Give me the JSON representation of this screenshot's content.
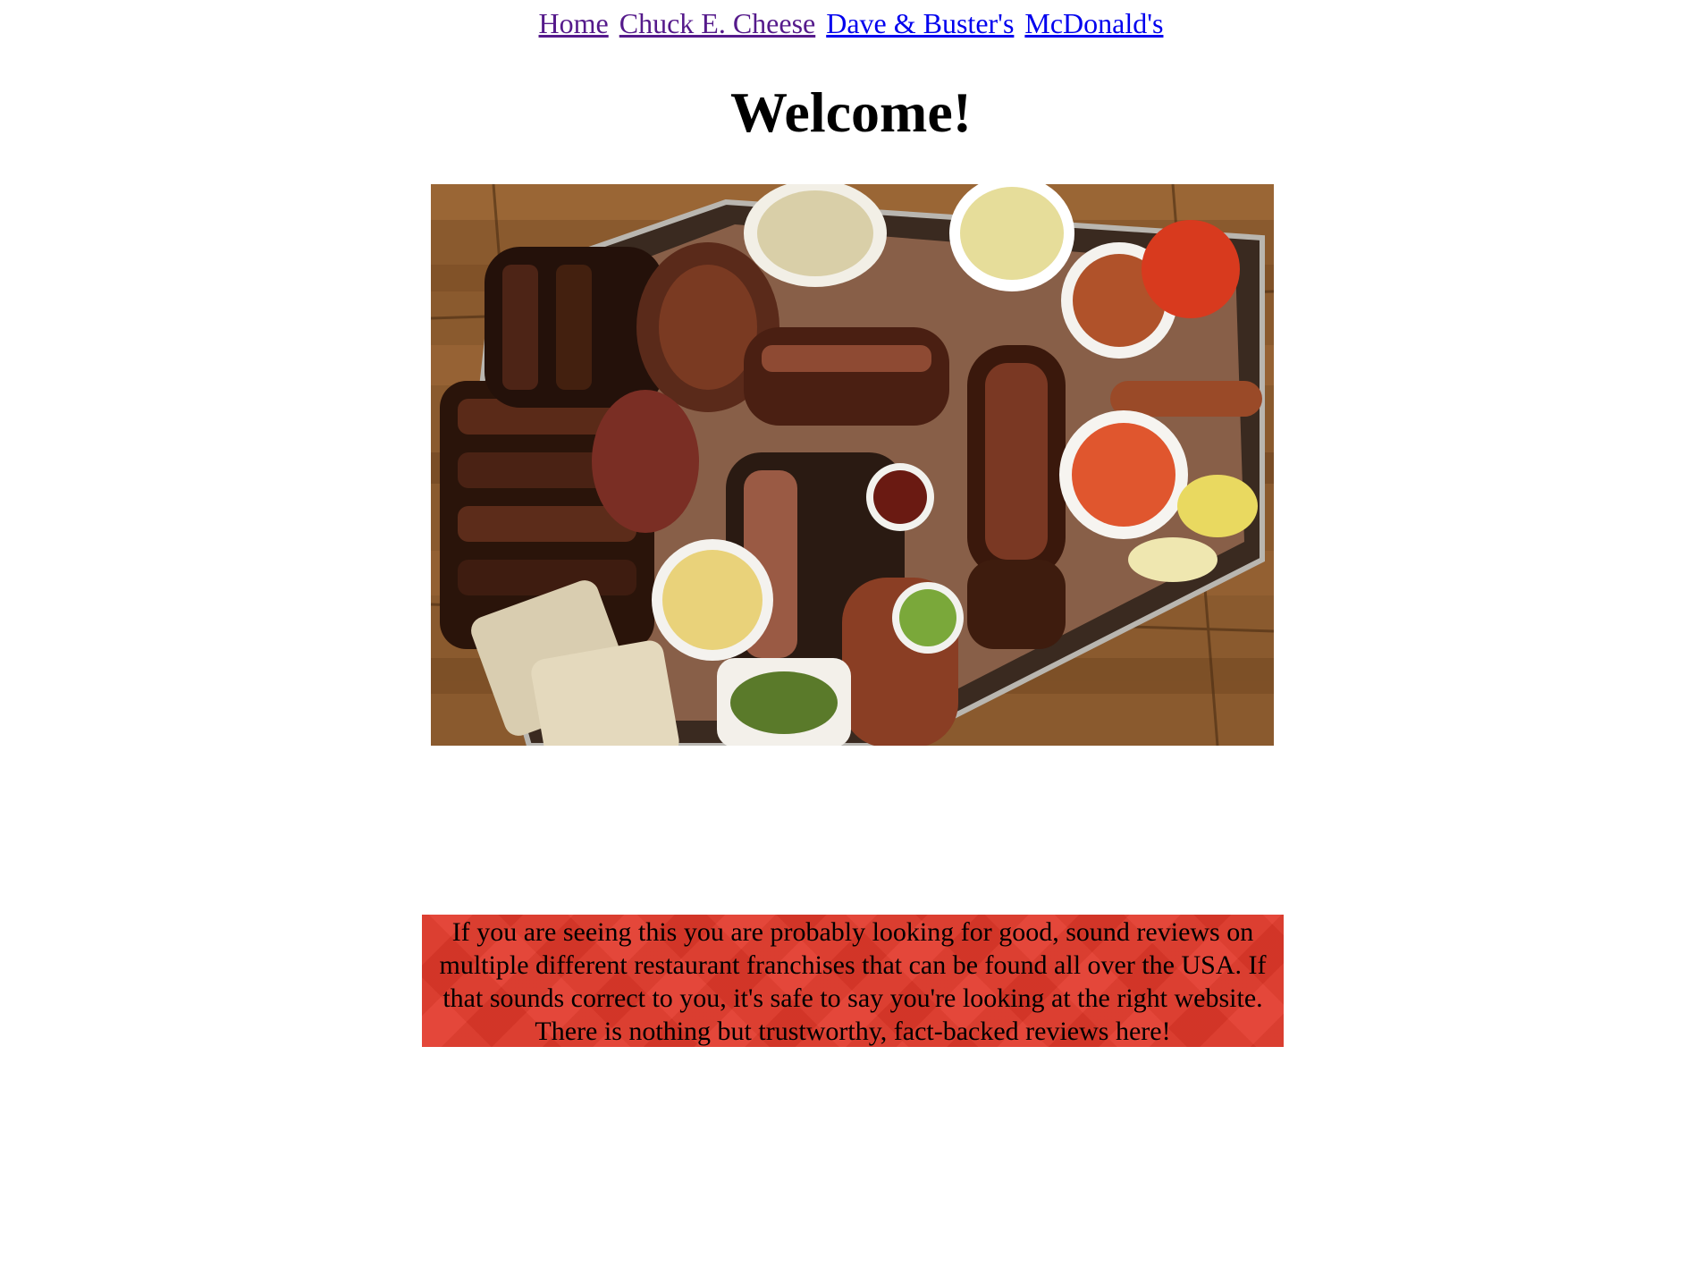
{
  "nav": {
    "links": [
      {
        "label": "Home",
        "visited": true
      },
      {
        "label": "Chuck E. Cheese",
        "visited": true
      },
      {
        "label": "Dave & Buster's",
        "visited": false
      },
      {
        "label": "McDonald's",
        "visited": false
      }
    ]
  },
  "page": {
    "title": "Welcome!"
  },
  "hero": {
    "subject": "barbecue platter photo"
  },
  "intro": {
    "text": "If you are seeing this you are probably looking for good, sound reviews on multiple different restaurant franchises that can be found all over the USA. If that sounds correct to you, it's safe to say you're looking at the right website. There is nothing but trustworthy, fact-backed reviews here!"
  },
  "colors": {
    "link": "#0000ee",
    "visited_link": "#551a8b",
    "intro_background": "#e2392a"
  }
}
